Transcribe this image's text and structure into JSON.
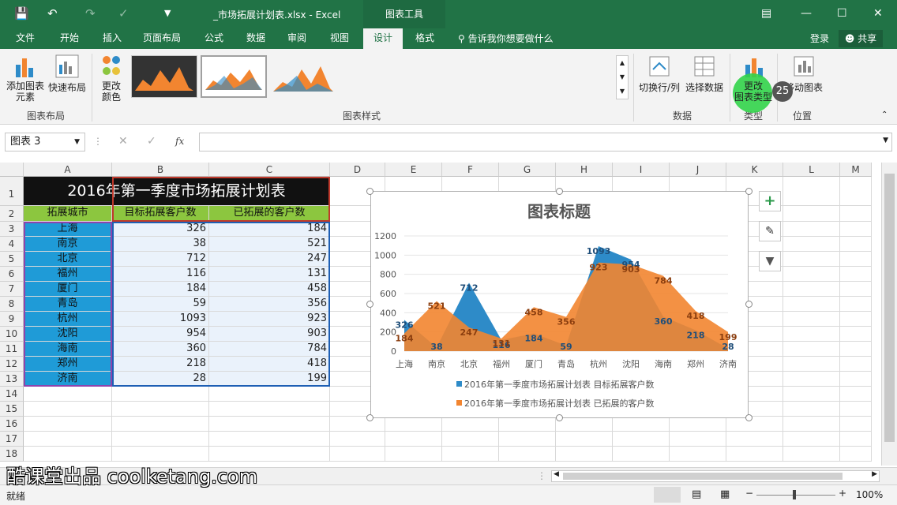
{
  "window": {
    "title": "_市场拓展计划表.xlsx - Excel",
    "context_tab": "图表工具",
    "login": "登录",
    "share": "共享",
    "tell_me": "告诉我你想要做什么"
  },
  "tabs": [
    "文件",
    "开始",
    "插入",
    "页面布局",
    "公式",
    "数据",
    "审阅",
    "视图",
    "设计",
    "格式"
  ],
  "active_tab": "设计",
  "ribbon": {
    "add_element": "添加图表\n元素",
    "quick_layout": "快速布局",
    "change_colors": "更改\n颜色",
    "group_layout": "图表布局",
    "group_styles": "图表样式",
    "switch_row_col": "切换行/列",
    "select_data": "选择数据",
    "group_data": "数据",
    "change_type": "更改\n图表类型",
    "group_type": "类型",
    "move_chart": "移动图表",
    "group_location": "位置",
    "step_badge": "25"
  },
  "formula_bar": {
    "name_box": "图表 3",
    "fx": "fx",
    "content": ""
  },
  "columns": [
    "A",
    "B",
    "C",
    "D",
    "E",
    "F",
    "G",
    "H",
    "I",
    "J",
    "K",
    "L",
    "M"
  ],
  "rows": [
    "1",
    "2",
    "3",
    "4",
    "5",
    "6",
    "7",
    "8",
    "9",
    "10",
    "11",
    "12",
    "13",
    "14",
    "15",
    "16",
    "17",
    "18"
  ],
  "sheet": {
    "title": "2016年第一季度市场拓展计划表",
    "headers": [
      "拓展城市",
      "目标拓展客户数",
      "已拓展的客户数"
    ],
    "data": [
      [
        "上海",
        "326",
        "184"
      ],
      [
        "南京",
        "38",
        "521"
      ],
      [
        "北京",
        "712",
        "247"
      ],
      [
        "福州",
        "116",
        "131"
      ],
      [
        "厦门",
        "184",
        "458"
      ],
      [
        "青岛",
        "59",
        "356"
      ],
      [
        "杭州",
        "1093",
        "923"
      ],
      [
        "沈阳",
        "954",
        "903"
      ],
      [
        "海南",
        "360",
        "784"
      ],
      [
        "郑州",
        "218",
        "418"
      ],
      [
        "济南",
        "28",
        "199"
      ]
    ]
  },
  "status": {
    "ready": "就绪",
    "zoom": "100%"
  },
  "watermark": "酷课堂出品 coolketang.com",
  "chart_data": {
    "type": "area",
    "title": "图表标题",
    "categories": [
      "上海",
      "南京",
      "北京",
      "福州",
      "厦门",
      "青岛",
      "杭州",
      "沈阳",
      "海南",
      "郑州",
      "济南"
    ],
    "series": [
      {
        "name": "2016年第一季度市场拓展计划表 目标拓展客户数",
        "values": [
          326,
          38,
          712,
          116,
          184,
          59,
          1093,
          954,
          360,
          218,
          28
        ],
        "color": "#2e8bc8"
      },
      {
        "name": "2016年第一季度市场拓展计划表 已拓展的客户数",
        "values": [
          184,
          521,
          247,
          131,
          458,
          356,
          923,
          903,
          784,
          418,
          199
        ],
        "color": "#f28530"
      }
    ],
    "ylim": [
      0,
      1200
    ],
    "yticks": [
      "0",
      "200",
      "400",
      "600",
      "800",
      "1000",
      "1200"
    ],
    "grid": true,
    "legend": "bottom",
    "data_labels": true
  },
  "colors": {
    "excel_green": "#217346",
    "header_green": "#8cc63f",
    "city_blue": "#1f9bd7"
  }
}
